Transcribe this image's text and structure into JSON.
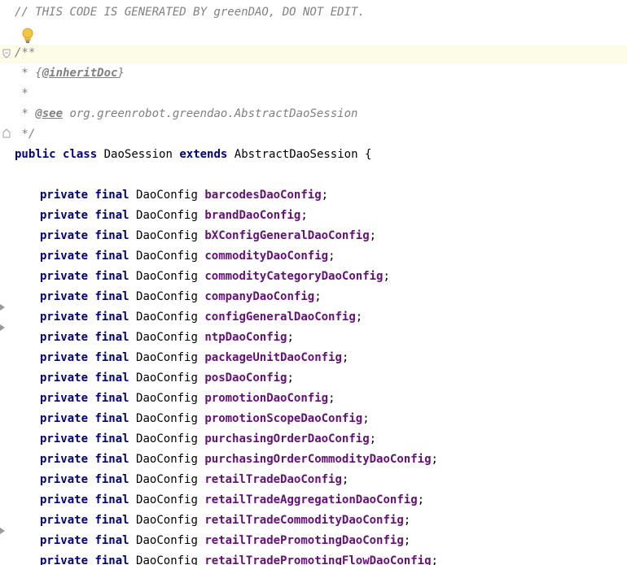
{
  "header_comment": "// THIS CODE IS GENERATED BY greenDAO, DO NOT EDIT.",
  "javadoc": {
    "open": "/**",
    "line_inherit_prefix": " * ",
    "inherit_open": "{",
    "inherit_tag": "@inheritDoc",
    "inherit_close": "}",
    "blank": " *",
    "see_prefix": " * ",
    "see_tag": "@see",
    "see_text": " org.greenrobot.greendao.AbstractDaoSession",
    "close": " */"
  },
  "class_decl": {
    "kw_public": "public",
    "kw_class": "class",
    "name": "DaoSession",
    "kw_extends": "extends",
    "parent": "AbstractDaoSession",
    "brace": " {"
  },
  "field_modifiers": {
    "private": "private",
    "final": "final",
    "type": "DaoConfig",
    "semicolon": ";"
  },
  "fields": [
    {
      "name": "barcodesDaoConfig"
    },
    {
      "name": "brandDaoConfig"
    },
    {
      "name": "bXConfigGeneralDaoConfig"
    },
    {
      "name": "commodityDaoConfig"
    },
    {
      "name": "commodityCategoryDaoConfig"
    },
    {
      "name": "companyDaoConfig"
    },
    {
      "name": "configGeneralDaoConfig"
    },
    {
      "name": "ntpDaoConfig"
    },
    {
      "name": "packageUnitDaoConfig"
    },
    {
      "name": "posDaoConfig"
    },
    {
      "name": "promotionDaoConfig"
    },
    {
      "name": "promotionScopeDaoConfig"
    },
    {
      "name": "purchasingOrderDaoConfig"
    },
    {
      "name": "purchasingOrderCommodityDaoConfig"
    },
    {
      "name": "retailTradeDaoConfig"
    },
    {
      "name": "retailTradeAggregationDaoConfig"
    },
    {
      "name": "retailTradeCommodityDaoConfig"
    },
    {
      "name": "retailTradePromotingDaoConfig"
    },
    {
      "name": "retailTradePromotingFlowDaoConfig"
    }
  ],
  "colors": {
    "keyword": "#000080",
    "field": "#660e7a",
    "comment": "#808080",
    "caret_line": "#fdfce6"
  },
  "icons": {
    "intention": "lightbulb-icon",
    "fold": "fold-marker-icon",
    "gutter": "gutter-arrow-icon"
  }
}
